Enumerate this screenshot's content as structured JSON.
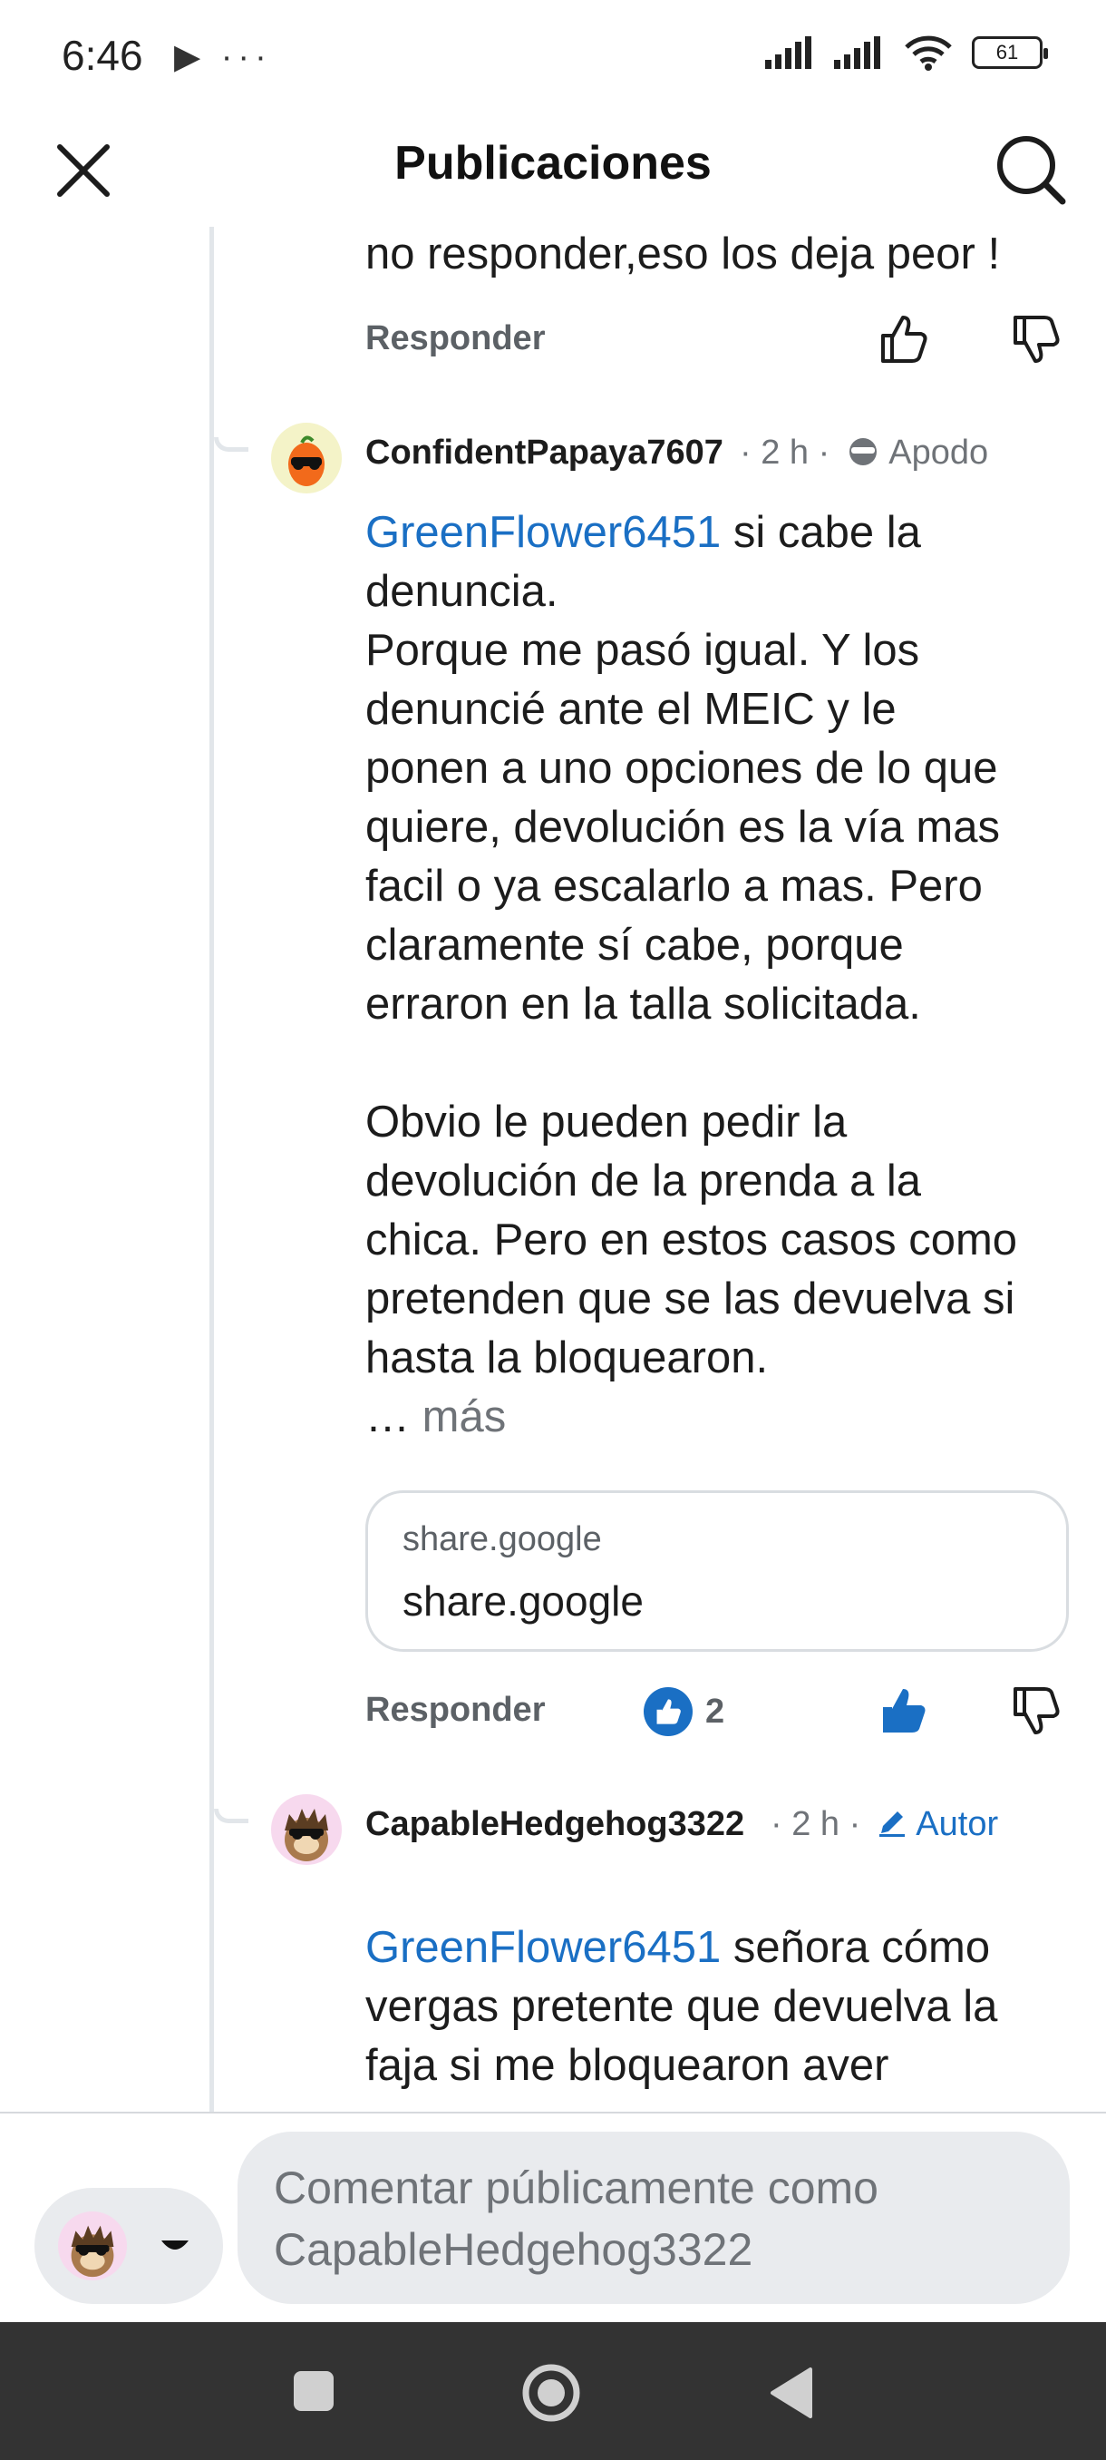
{
  "status_bar": {
    "time": "6:46",
    "left_icons": "▶ ···",
    "battery": "61"
  },
  "header": {
    "title": "Publicaciones"
  },
  "prev_comment": {
    "tail_text": "no responder,eso los deja peor !",
    "reply_label": "Responder"
  },
  "comment1": {
    "username": "ConfidentPapaya7607",
    "time": "· 2 h ·",
    "flair": "Apodo",
    "mention": "GreenFlower6451",
    "line1_rest": " si cabe la",
    "lines": [
      "denuncia.",
      "Porque me pasó igual. Y los",
      "denuncié ante el MEIC y le",
      "ponen a uno opciones de lo que",
      "quiere, devolución es la vía mas",
      "facil o ya escalarlo a mas. Pero",
      "claramente sí cabe, porque",
      "erraron en la talla solicitada.",
      "",
      "Obvio le pueden pedir la",
      "devolución de la prenda a la",
      "chica. Pero en estos casos como",
      "pretenden que se las devuelva si",
      "hasta la bloquearon."
    ],
    "ellipsis": "…",
    "more": "más",
    "link": {
      "domain": "share.google",
      "title": "share.google"
    },
    "reply_label": "Responder",
    "upvotes": "2",
    "avatar_icon": "papaya-sunglasses-avatar"
  },
  "comment2": {
    "username": "CapableHedgehog3322",
    "time": "· 2 h ·",
    "flair": "Autor",
    "mention": "GreenFlower6451",
    "line1_rest": " señora cómo",
    "lines": [
      "vergas pretente que devuelva la",
      "faja si me bloquearon aver"
    ],
    "avatar_icon": "hedgehog-sunglasses-avatar"
  },
  "comment_bar": {
    "placeholder_line1": "Comentar públicamente como",
    "placeholder_line2": "CapableHedgehog3322"
  },
  "colors": {
    "accent": "#1a6fc4",
    "thread_line": "#e2e6ea",
    "muted": "#6f7378",
    "nav_bg": "#333333"
  }
}
